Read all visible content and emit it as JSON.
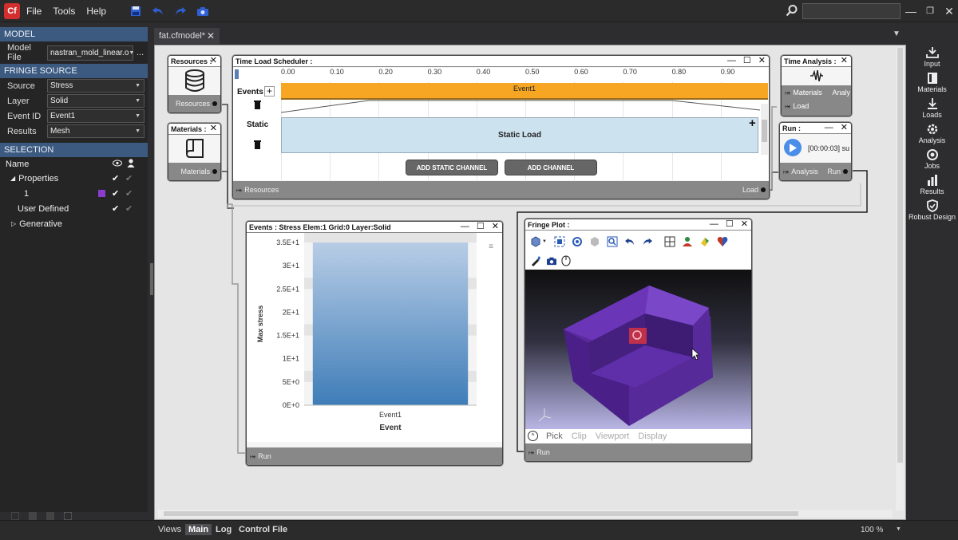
{
  "app": {
    "logo": "Cf",
    "menu": [
      "File",
      "Tools",
      "Help"
    ],
    "search_placeholder": ""
  },
  "left": {
    "model_header": "MODEL",
    "model_file_label": "Model File",
    "model_file_value": "nastran_mold_linear.o",
    "model_file_more": "...",
    "fringe_header": "FRINGE SOURCE",
    "source_label": "Source",
    "source_value": "Stress",
    "layer_label": "Layer",
    "layer_value": "Solid",
    "eventid_label": "Event ID",
    "eventid_value": "Event1",
    "results_label": "Results",
    "results_value": "Mesh",
    "selection_header": "SELECTION",
    "name_col": "Name",
    "tree": {
      "properties": "Properties",
      "item1": "1",
      "user_defined": "User Defined",
      "generative": "Generative"
    },
    "item_color": "#8a3ccf"
  },
  "doc_tab": "fat.cfmodel*",
  "nodes": {
    "resources": {
      "title": "Resources :",
      "port": "Resources"
    },
    "materials": {
      "title": "Materials :",
      "port": "Materials"
    },
    "scheduler": {
      "title": "Time Load Scheduler :",
      "ticks": [
        "0.00",
        "0.10",
        "0.20",
        "0.30",
        "0.40",
        "0.50",
        "0.60",
        "0.70",
        "0.80",
        "0.90"
      ],
      "events_label": "Events",
      "static_label": "Static",
      "event1": "Event1",
      "static_load": "Static Load",
      "add_static": "ADD STATIC CHANNEL",
      "add_channel": "ADD CHANNEL",
      "in_port": "Resources",
      "out_port": "Load"
    },
    "time_analysis": {
      "title": "Time Analysis :",
      "port_materials": "Materials",
      "port_load": "Load",
      "out_port": "Analy"
    },
    "run": {
      "title": "Run :",
      "time": "[00:00:03] su",
      "in_port": "Analysis",
      "out_port": "Run"
    },
    "events": {
      "title": "Events : Stress Elem:1 Grid:0 Layer:Solid",
      "port": "Run"
    },
    "fringe": {
      "title": "Fringe Plot :",
      "modes": [
        "Pick",
        "Clip",
        "Viewport",
        "Display"
      ],
      "port": "Run"
    }
  },
  "chart_data": {
    "type": "bar",
    "categories": [
      "Event1"
    ],
    "values": [
      35
    ],
    "ylabel": "Max stress",
    "xlabel": "Event",
    "yticks": [
      "0E+0",
      "5E+0",
      "1E+1",
      "1.5E+1",
      "2E+1",
      "2.5E+1",
      "3E+1",
      "3.5E+1"
    ],
    "ylim": [
      0,
      35
    ],
    "bar_color_top": "#b8cde6",
    "bar_color_bottom": "#3f7db8"
  },
  "rail": [
    "Input",
    "Materials",
    "Loads",
    "Analysis",
    "Jobs",
    "Results",
    "Robust Design"
  ],
  "bottom": {
    "tabs": [
      "Views",
      "Main",
      "Log",
      "Control File"
    ],
    "zoom": "100 %"
  }
}
